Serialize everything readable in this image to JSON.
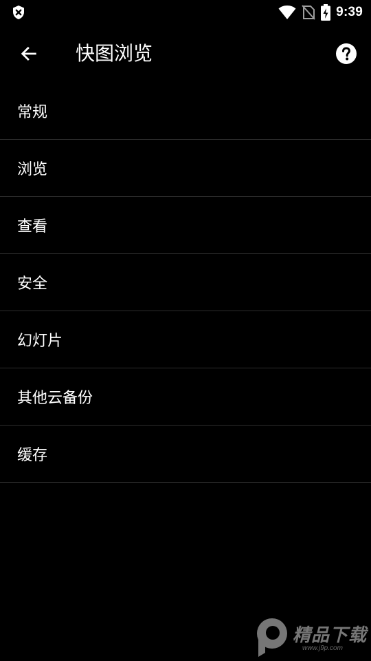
{
  "status_bar": {
    "time": "9:39",
    "icons": [
      "shield-x-icon",
      "wifi-icon",
      "no-sim-icon",
      "battery-charging-icon"
    ]
  },
  "app_bar": {
    "title": "快图浏览",
    "back_icon": "arrow-left-icon",
    "help_icon": "help-circle-icon"
  },
  "settings": {
    "items": [
      {
        "label": "常规"
      },
      {
        "label": "浏览"
      },
      {
        "label": "查看"
      },
      {
        "label": "安全"
      },
      {
        "label": "幻灯片"
      },
      {
        "label": "其他云备份"
      },
      {
        "label": "缓存"
      }
    ]
  },
  "watermark": {
    "text": "精品下载",
    "url": "www.j9p.com"
  },
  "colors": {
    "background": "#000000",
    "text": "#ffffff",
    "divider": "#2e2e2e"
  }
}
